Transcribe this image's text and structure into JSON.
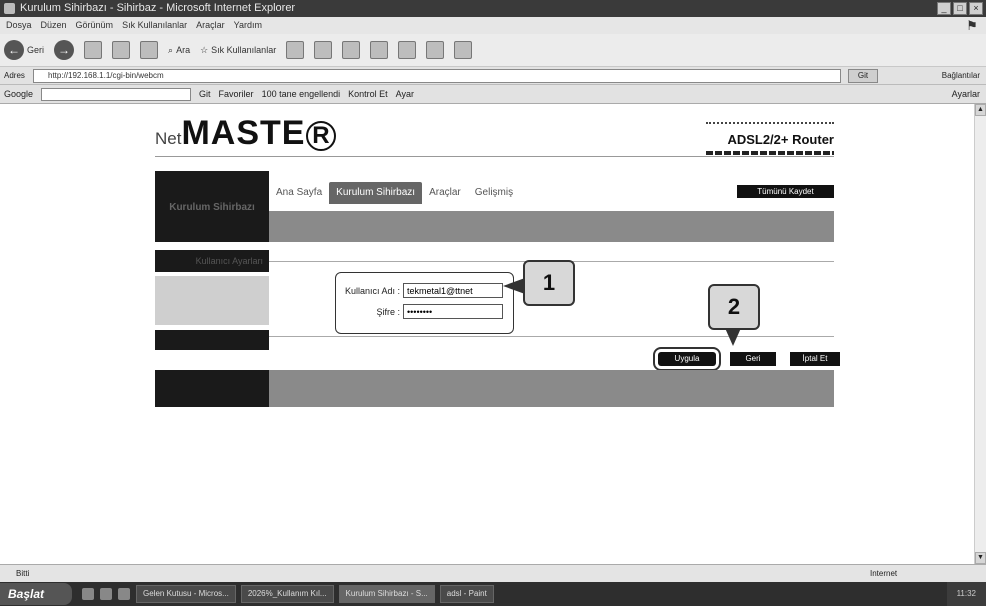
{
  "window": {
    "title": "Kurulum Sihirbazı - Sihirbaz - Microsoft Internet Explorer",
    "controls": [
      "_",
      "□",
      "×"
    ]
  },
  "menu": [
    "Dosya",
    "Düzen",
    "Görünüm",
    "Sık Kullanılanlar",
    "Araçlar",
    "Yardım"
  ],
  "toolbar": {
    "back_label": "Geri",
    "search_label": "Ara",
    "favorites_label": "Sık Kullanılanlar"
  },
  "address": {
    "label": "Adres",
    "url": "http://192.168.1.1/cgi-bin/webcm",
    "go_label": "Git",
    "links_label": "Bağlantılar"
  },
  "googlebar": {
    "brand": "Google",
    "items": [
      "Git",
      "Favoriler",
      "100 tane engellendi",
      "Kontrol Et",
      "Ayar"
    ],
    "options_label": "Ayarlar"
  },
  "router": {
    "brand_prefix": "Net",
    "brand_main": "MASTE",
    "brand_r": "R",
    "model": "ADSL2/2+ Router",
    "side_title": "Kurulum Sihirbazı",
    "nav": [
      "Ana Sayfa",
      "Kurulum Sihirbazı",
      "Araçlar",
      "Gelişmiş"
    ],
    "save_restart": "Tümünü Kaydet",
    "side_sub": "Kullanıcı Ayarları",
    "form": {
      "user_label": "Kullanıcı Adı :",
      "user_value": "tekmetal1@ttnet",
      "pass_label": "Şifre :",
      "pass_value": "••••••••"
    },
    "buttons": {
      "apply": "Uygula",
      "back": "Geri",
      "cancel": "İptal Et"
    }
  },
  "callouts": {
    "one": "1",
    "two": "2"
  },
  "status": {
    "left": "Bitti",
    "zone": "Internet"
  },
  "taskbar": {
    "start": "Başlat",
    "tasks": [
      "Gelen Kutusu - Micros...",
      "2026%_Kullanım Kıl...",
      "Kurulum Sihirbazı - S...",
      "adsl - Paint"
    ],
    "tray": "11:32"
  }
}
